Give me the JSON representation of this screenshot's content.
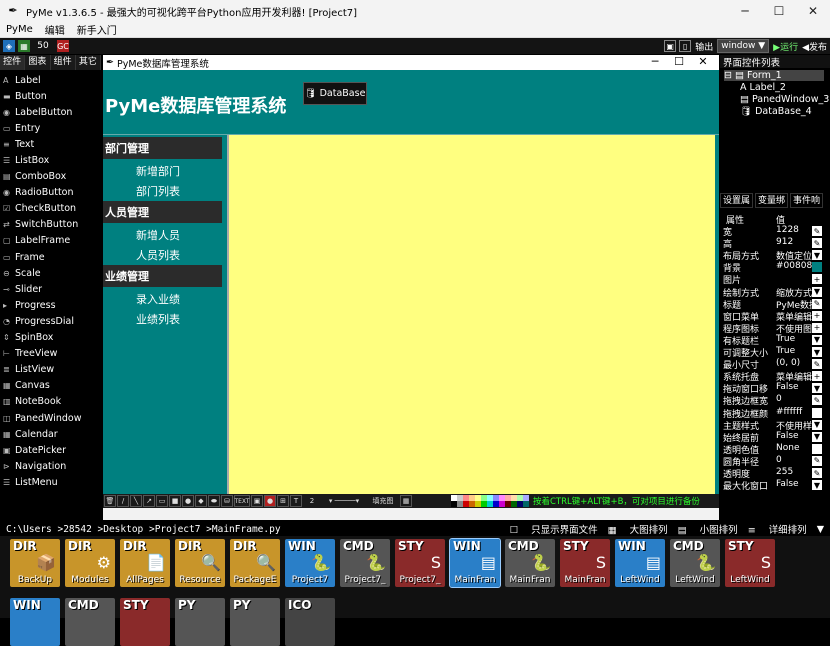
{
  "window": {
    "title": "PyMe v1.3.6.5 -  最强大的可视化跨平台Python应用开发利器!   [Project7]",
    "minimize": "─",
    "maximize": "☐",
    "close": "✕"
  },
  "menu": [
    "PyMe",
    "编辑",
    "新手入门"
  ],
  "toolbar": {
    "zoom": "50",
    "output_label": "输出",
    "platform_select": "window",
    "run_label": "▶运行",
    "publish_label": "◀发布"
  },
  "palette_tabs": [
    "控件",
    "图表",
    "组件",
    "其它"
  ],
  "palette": [
    {
      "icon": "A",
      "label": "Label"
    },
    {
      "icon": "▬",
      "label": "Button"
    },
    {
      "icon": "◉",
      "label": "LabelButton"
    },
    {
      "icon": "▭",
      "label": "Entry"
    },
    {
      "icon": "≡",
      "label": "Text"
    },
    {
      "icon": "☰",
      "label": "ListBox"
    },
    {
      "icon": "▤",
      "label": "ComboBox"
    },
    {
      "icon": "◉",
      "label": "RadioButton"
    },
    {
      "icon": "☑",
      "label": "CheckButton"
    },
    {
      "icon": "⇄",
      "label": "SwitchButton"
    },
    {
      "icon": "▢",
      "label": "LabelFrame"
    },
    {
      "icon": "▭",
      "label": "Frame"
    },
    {
      "icon": "⊖",
      "label": "Scale"
    },
    {
      "icon": "⊸",
      "label": "Slider"
    },
    {
      "icon": "▸",
      "label": "Progress"
    },
    {
      "icon": "◔",
      "label": "ProgressDial"
    },
    {
      "icon": "⇕",
      "label": "SpinBox"
    },
    {
      "icon": "⊢",
      "label": "TreeView"
    },
    {
      "icon": "≣",
      "label": "ListView"
    },
    {
      "icon": "▦",
      "label": "Canvas"
    },
    {
      "icon": "▥",
      "label": "NoteBook"
    },
    {
      "icon": "◫",
      "label": "PanedWindow"
    },
    {
      "icon": "▦",
      "label": "Calendar"
    },
    {
      "icon": "▣",
      "label": "DatePicker"
    },
    {
      "icon": "⊳",
      "label": "Navigation"
    },
    {
      "icon": "☰",
      "label": "ListMenu"
    }
  ],
  "designer": {
    "form_title": "PyMe数据库管理系统",
    "app_title": "PyMe数据库管理系统",
    "db_button": "DataBase",
    "sections": [
      {
        "head": "部门管理",
        "items": [
          "新增部门",
          "部门列表"
        ]
      },
      {
        "head": "人员管理",
        "items": [
          "新增人员",
          "人员列表"
        ]
      },
      {
        "head": "业绩管理",
        "items": [
          "录入业绩",
          "业绩列表"
        ]
      }
    ],
    "toolbar_spin": "2",
    "toolbar_fill": "填充图",
    "toolbar_text": "TEXT",
    "hint": "按着CTRL键+ALT键+B，可对项目进行备份"
  },
  "right_panel": {
    "title": "界面控件列表",
    "tree": [
      "Form_1",
      "Label_2",
      "PanedWindow_3",
      "DataBase_4"
    ],
    "tabs": [
      "设置属",
      "变量绑",
      "事件响"
    ],
    "prop_header": [
      "属性",
      "值"
    ],
    "props": [
      {
        "k": "宽",
        "v": "1228",
        "b": "✎"
      },
      {
        "k": "高",
        "v": "912",
        "b": "✎"
      },
      {
        "k": "布局方式",
        "v": "数值定位",
        "b": "▼"
      },
      {
        "k": "背景",
        "v": "#008080",
        "b": ""
      },
      {
        "k": "图片",
        "v": "",
        "b": "+"
      },
      {
        "k": "绘制方式",
        "v": "缩放方式",
        "b": "▼"
      },
      {
        "k": "标题",
        "v": "PyMe数据",
        "b": "✎"
      },
      {
        "k": "窗口菜单",
        "v": "菜单编辑",
        "b": "+"
      },
      {
        "k": "程序图标",
        "v": "不使用图",
        "b": "+"
      },
      {
        "k": "有标题栏",
        "v": "True",
        "b": "▼"
      },
      {
        "k": "可调整大小",
        "v": "True",
        "b": "▼"
      },
      {
        "k": "最小尺寸",
        "v": "(0, 0)",
        "b": "✎"
      },
      {
        "k": "系统托盘",
        "v": "菜单编辑",
        "b": "+"
      },
      {
        "k": "拖动窗口移",
        "v": "False",
        "b": "▼"
      },
      {
        "k": "拖拽边框宽",
        "v": "0",
        "b": "✎"
      },
      {
        "k": "拖拽边框颜",
        "v": "#ffffff",
        "b": ""
      },
      {
        "k": "主题样式",
        "v": "不使用样",
        "b": "▼"
      },
      {
        "k": "始终居前",
        "v": "False",
        "b": "▼"
      },
      {
        "k": "透明色值",
        "v": "None",
        "b": ""
      },
      {
        "k": "圆角半径",
        "v": "0",
        "b": "✎"
      },
      {
        "k": "透明度",
        "v": "255",
        "b": "✎"
      },
      {
        "k": "最大化窗口",
        "v": "False",
        "b": "▼"
      }
    ]
  },
  "pathbar": {
    "path": "C:\\Users >28542 >Desktop >Project7 >MainFrame.py",
    "only_ui": "只显示界面文件",
    "large": "大图排列",
    "small": "小图排列",
    "detail": "详细排列"
  },
  "files": [
    {
      "type": "DIR",
      "name": "BackUp",
      "color": "#c8952a",
      "glyph": "📦"
    },
    {
      "type": "DIR",
      "name": "Modules",
      "color": "#c8952a",
      "glyph": "⚙"
    },
    {
      "type": "DIR",
      "name": "AllPages",
      "color": "#c8952a",
      "glyph": "📄"
    },
    {
      "type": "DIR",
      "name": "Resource",
      "color": "#c8952a",
      "glyph": "🔍"
    },
    {
      "type": "DIR",
      "name": "PackageE",
      "color": "#c8952a",
      "glyph": "🔍"
    },
    {
      "type": "WIN",
      "name": "Project7",
      "color": "#2a7fc8",
      "glyph": "🐍"
    },
    {
      "type": "CMD",
      "name": "Project7_",
      "color": "#555555",
      "glyph": "🐍"
    },
    {
      "type": "STY",
      "name": "Project7_",
      "color": "#8a2a2a",
      "glyph": "S"
    },
    {
      "type": "WIN",
      "name": "MainFran",
      "color": "#2a7fc8",
      "glyph": "▤"
    },
    {
      "type": "CMD",
      "name": "MainFran",
      "color": "#555555",
      "glyph": "🐍"
    },
    {
      "type": "STY",
      "name": "MainFran",
      "color": "#8a2a2a",
      "glyph": "S"
    },
    {
      "type": "WIN",
      "name": "LeftWind",
      "color": "#2a7fc8",
      "glyph": "▤"
    },
    {
      "type": "CMD",
      "name": "LeftWind",
      "color": "#555555",
      "glyph": "🐍"
    },
    {
      "type": "STY",
      "name": "LeftWind",
      "color": "#8a2a2a",
      "glyph": "S"
    },
    {
      "type": "WIN",
      "name": "",
      "color": "#2a7fc8",
      "glyph": ""
    },
    {
      "type": "CMD",
      "name": "",
      "color": "#555555",
      "glyph": ""
    },
    {
      "type": "STY",
      "name": "",
      "color": "#8a2a2a",
      "glyph": ""
    },
    {
      "type": "PY",
      "name": "",
      "color": "#555555",
      "glyph": ""
    },
    {
      "type": "PY",
      "name": "",
      "color": "#555555",
      "glyph": ""
    },
    {
      "type": "ICO",
      "name": "",
      "color": "#444444",
      "glyph": ""
    }
  ]
}
